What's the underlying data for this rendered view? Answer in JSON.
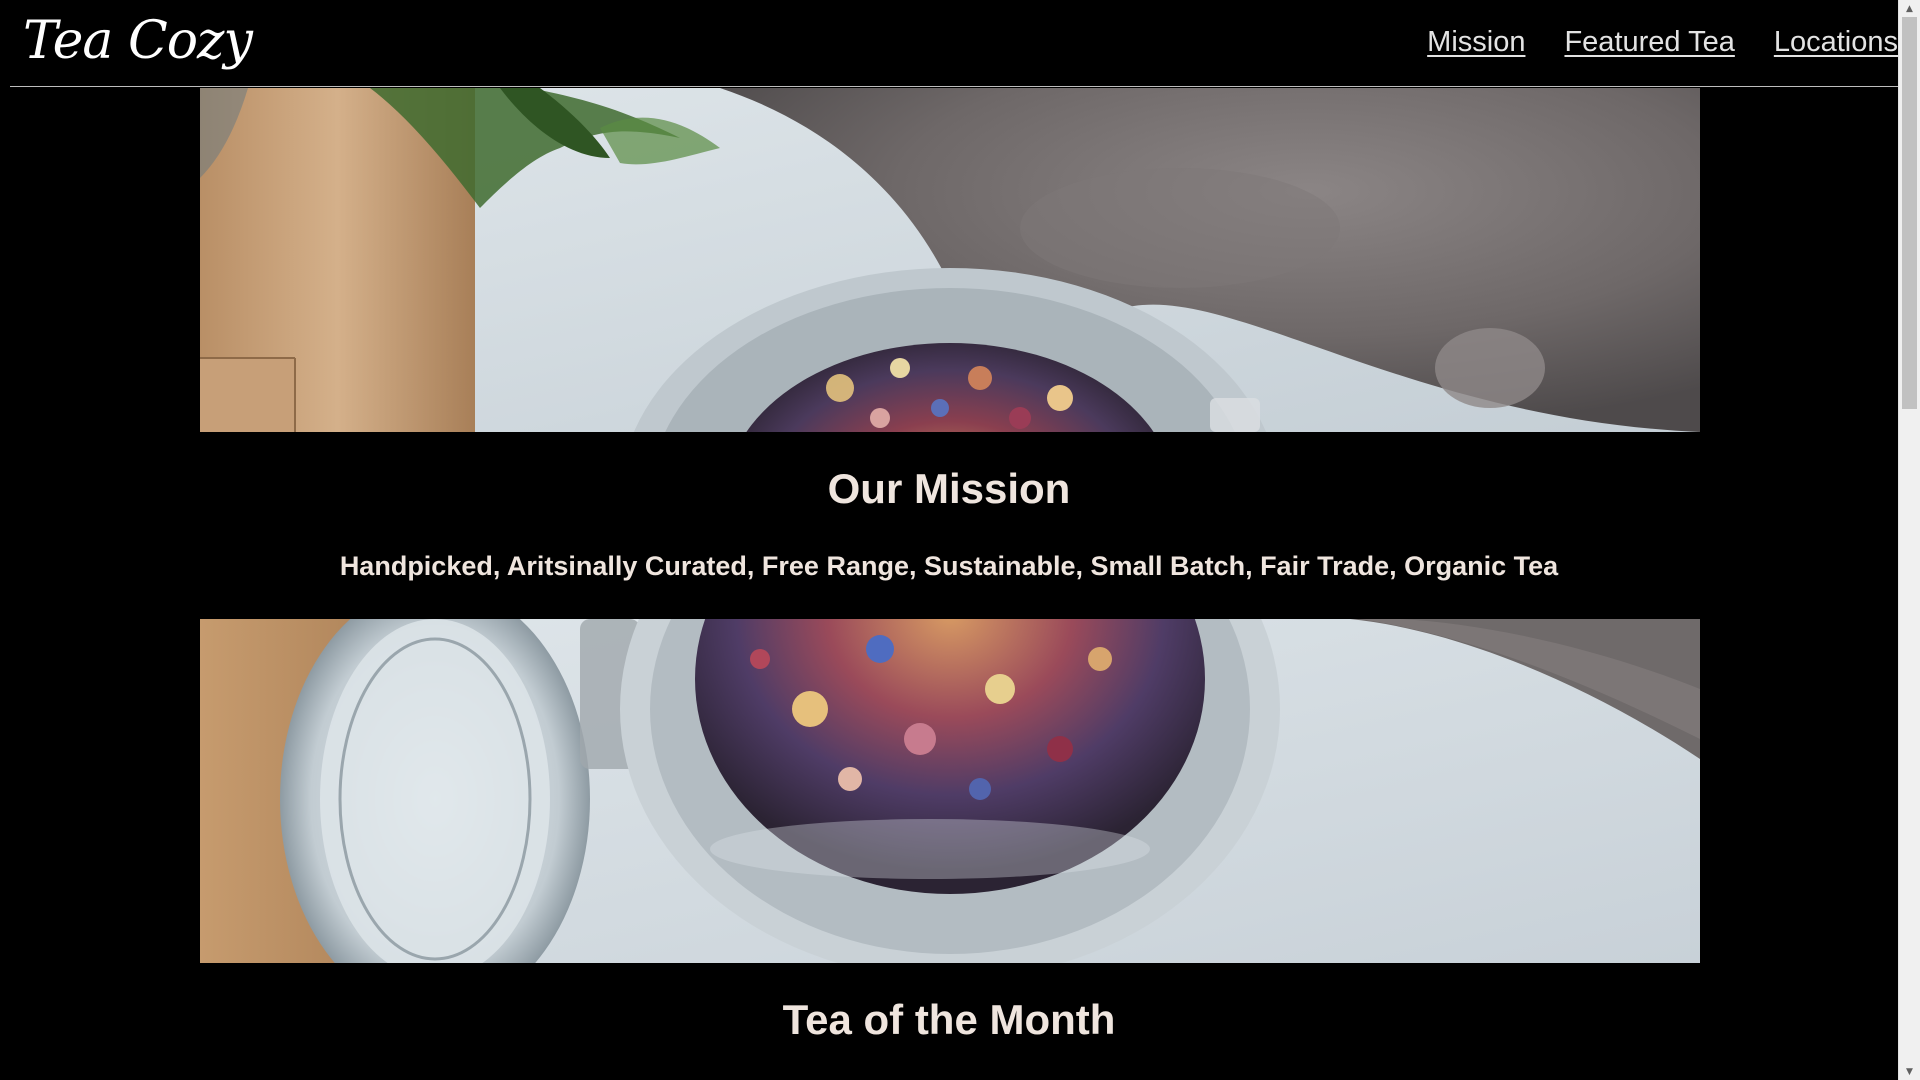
{
  "header": {
    "logo": "Tea Cozy",
    "nav": [
      {
        "label": "Mission"
      },
      {
        "label": "Featured Tea"
      },
      {
        "label": "Locations"
      }
    ]
  },
  "mission": {
    "title": "Our Mission",
    "tagline": "Handpicked, Aritsinally Curated, Free Range, Sustainable, Small Batch, Fair Trade, Organic Tea"
  },
  "tea_of_month": {
    "title": "Tea of the Month"
  },
  "scrollbar": {
    "up_icon": "triangle-up",
    "down_icon": "triangle-down"
  }
}
